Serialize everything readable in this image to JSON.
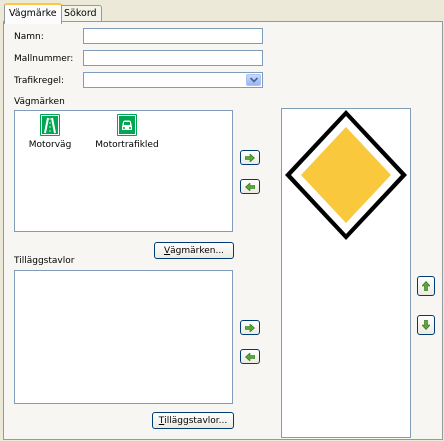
{
  "tabs": [
    {
      "label": "Vägmärke",
      "active": true
    },
    {
      "label": "Sökord",
      "active": false
    }
  ],
  "form": {
    "name_label": "Namn:",
    "name_value": "",
    "mallnummer_label": "Mallnummer:",
    "mallnummer_value": "",
    "trafikregel_label": "Trafikregel:",
    "trafikregel_value": ""
  },
  "vagmarken": {
    "label": "Vägmärken",
    "items": [
      {
        "label": "Motorväg",
        "icon": "motorway-sign-icon"
      },
      {
        "label": "Motortrafikled",
        "icon": "motortrafikled-sign-icon"
      }
    ],
    "button_accel": "V",
    "button_rest": "ägmärken..."
  },
  "tillaggstavlor": {
    "label": "Tilläggstavlor",
    "button_accel": "T",
    "button_rest": "illäggstavlor..."
  },
  "colors": {
    "sign_green": "#00a651",
    "priority_yellow": "#f9c83c",
    "accent": "#ffc83c"
  }
}
